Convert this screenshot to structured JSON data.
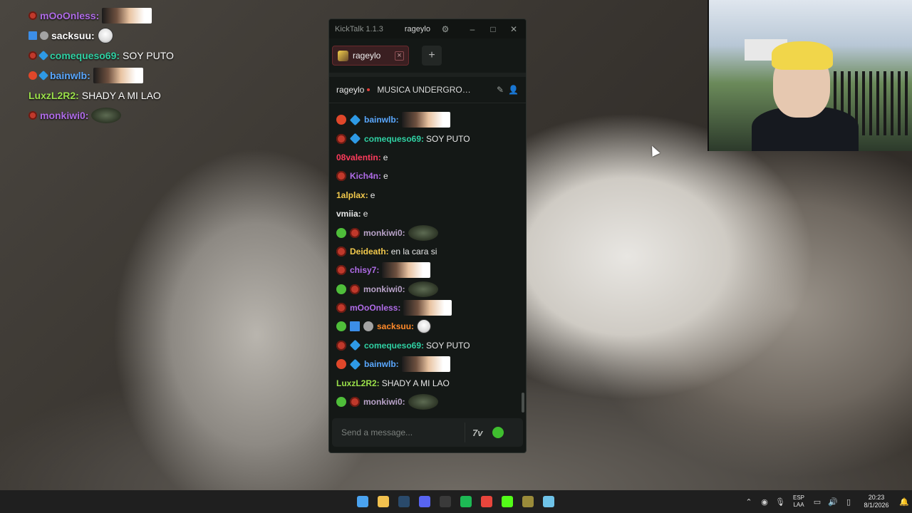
{
  "overlay_chat": [
    {
      "badges": [
        "red"
      ],
      "user": "mOoOnless",
      "color": "#b06ce8",
      "emote": "photo",
      "text": ""
    },
    {
      "badges": [
        "sword",
        "grey"
      ],
      "user": "sacksuu",
      "color": "#ffffff",
      "emote": "round",
      "text": ""
    },
    {
      "badges": [
        "red",
        "blue"
      ],
      "user": "comequeso69",
      "color": "#2fd1a3",
      "emote": "",
      "text": "SOY PUTO"
    },
    {
      "badges": [
        "orange",
        "blue"
      ],
      "user": "bainwlb",
      "color": "#5aa8ff",
      "emote": "photo",
      "text": ""
    },
    {
      "badges": [],
      "user": "LuxzL2R2",
      "color": "#9be04a",
      "emote": "",
      "text": "SHADY A MI LAO"
    },
    {
      "badges": [
        "red"
      ],
      "user": "monkiwi0",
      "color": "#b06ce8",
      "emote": "blob",
      "text": ""
    }
  ],
  "window": {
    "app_title": "KickTalk 1.1.3",
    "channel_chip": "rageylo",
    "tab_label": "rageylo",
    "add_tab": "+",
    "close_tab": "×",
    "header_channel": "rageylo",
    "stream_title": "MUSICA UNDERGROUND",
    "input_placeholder": "Send a message...",
    "seven_tv": "7v"
  },
  "messages": [
    {
      "badges": [
        "orange",
        "blue"
      ],
      "user": "bainwlb",
      "color": "#5aa8ff",
      "emote": "photo",
      "text": ""
    },
    {
      "badges": [
        "red",
        "blue"
      ],
      "user": "comequeso69",
      "color": "#2fd1a3",
      "emote": "",
      "text": "SOY PUTO"
    },
    {
      "badges": [],
      "user": "08valentin",
      "color": "#ff3b5c",
      "emote": "",
      "text": "e"
    },
    {
      "badges": [
        "red"
      ],
      "user": "Kich4n",
      "color": "#b06ce8",
      "emote": "",
      "text": "e"
    },
    {
      "badges": [],
      "user": "1alplax",
      "color": "#f2c94c",
      "emote": "",
      "text": "e"
    },
    {
      "badges": [],
      "user": "vmiia",
      "color": "#e8e8e8",
      "emote": "",
      "text": "e"
    },
    {
      "badges": [
        "green",
        "red"
      ],
      "user": "monkiwi0",
      "color": "#b9a3c9",
      "emote": "blob",
      "text": ""
    },
    {
      "badges": [
        "red"
      ],
      "user": "Deideath",
      "color": "#f2c94c",
      "emote": "",
      "text": "en la cara si"
    },
    {
      "badges": [
        "red"
      ],
      "user": "chisy7",
      "color": "#b06ce8",
      "emote": "photo",
      "text": ""
    },
    {
      "badges": [
        "green",
        "red"
      ],
      "user": "monkiwi0",
      "color": "#b9a3c9",
      "emote": "blob",
      "text": ""
    },
    {
      "badges": [
        "red"
      ],
      "user": "mOoOnless",
      "color": "#b06ce8",
      "emote": "photo",
      "text": ""
    },
    {
      "badges": [
        "green",
        "sword",
        "grey"
      ],
      "user": "sacksuu",
      "color": "#ff8a2a",
      "emote": "round",
      "text": ""
    },
    {
      "badges": [
        "red",
        "blue"
      ],
      "user": "comequeso69",
      "color": "#2fd1a3",
      "emote": "",
      "text": "SOY PUTO"
    },
    {
      "badges": [
        "orange",
        "blue"
      ],
      "user": "bainwlb",
      "color": "#5aa8ff",
      "emote": "photo",
      "text": ""
    },
    {
      "badges": [],
      "user": "LuxzL2R2",
      "color": "#9be04a",
      "emote": "",
      "text": "SHADY A MI LAO"
    },
    {
      "badges": [
        "green",
        "red"
      ],
      "user": "monkiwi0",
      "color": "#b9a3c9",
      "emote": "blob",
      "text": ""
    }
  ],
  "taskbar": {
    "apps": [
      {
        "name": "start-icon",
        "color": "#4aa3f0"
      },
      {
        "name": "file-explorer-icon",
        "color": "#f2c14e"
      },
      {
        "name": "steam-icon",
        "color": "#2a4a6b"
      },
      {
        "name": "discord-icon",
        "color": "#5865f2"
      },
      {
        "name": "obs-icon",
        "color": "#3a3a3a"
      },
      {
        "name": "spotify-icon",
        "color": "#1db954"
      },
      {
        "name": "chrome-icon",
        "color": "#e8453c"
      },
      {
        "name": "kick-icon",
        "color": "#53fc18"
      },
      {
        "name": "app-icon",
        "color": "#9a8b3a"
      },
      {
        "name": "notepad-icon",
        "color": "#6fc3e8"
      }
    ],
    "lang_line1": "ESP",
    "lang_line2": "LAA",
    "time": "20:23",
    "date": "8/1/2026"
  }
}
